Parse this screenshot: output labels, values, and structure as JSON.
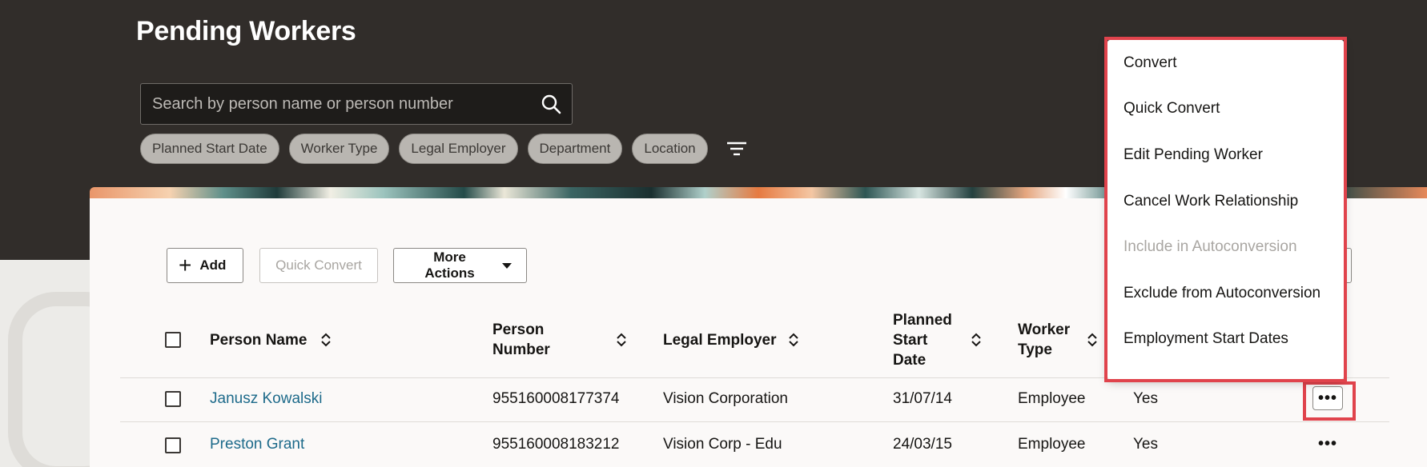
{
  "page": {
    "title": "Pending Workers"
  },
  "search": {
    "placeholder": "Search by person name or person number"
  },
  "filters": [
    "Planned Start Date",
    "Worker Type",
    "Legal Employer",
    "Department",
    "Location"
  ],
  "toolbar": {
    "add_label": "Add",
    "quick_convert_label": "Quick Convert",
    "more_actions_label": "More Actions"
  },
  "table": {
    "columns": {
      "person_name": "Person Name",
      "person_number_1": "Person",
      "person_number_2": "Number",
      "legal_employer": "Legal Employer",
      "planned_start_1": "Planned",
      "planned_start_2": "Start",
      "planned_start_3": "Date",
      "worker_type_1": "Worker",
      "worker_type_2": "Type"
    },
    "rows": [
      {
        "name": "Janusz Kowalski",
        "number": "955160008177374",
        "employer": "Vision Corporation",
        "start": "31/07/14",
        "type": "Employee",
        "auto": "Yes"
      },
      {
        "name": "Preston Grant",
        "number": "955160008183212",
        "employer": "Vision Corp - Edu",
        "start": "24/03/15",
        "type": "Employee",
        "auto": "Yes"
      }
    ]
  },
  "row_menu": {
    "items": [
      {
        "label": "Convert",
        "enabled": true
      },
      {
        "label": "Quick Convert",
        "enabled": true
      },
      {
        "label": "Edit Pending Worker",
        "enabled": true
      },
      {
        "label": "Cancel Work Relationship",
        "enabled": true
      },
      {
        "label": "Include in Autoconversion",
        "enabled": false
      },
      {
        "label": "Exclude from Autoconversion",
        "enabled": true
      },
      {
        "label": "Employment Start Dates",
        "enabled": true
      }
    ]
  },
  "icons": {
    "search": "search-icon",
    "filter": "filter-icon",
    "sort": "sort-icon",
    "overflow": "more-horizontal-icon"
  },
  "colors": {
    "header_bg": "#312d2a",
    "link": "#1d6a8a",
    "highlight": "#e0434c"
  }
}
